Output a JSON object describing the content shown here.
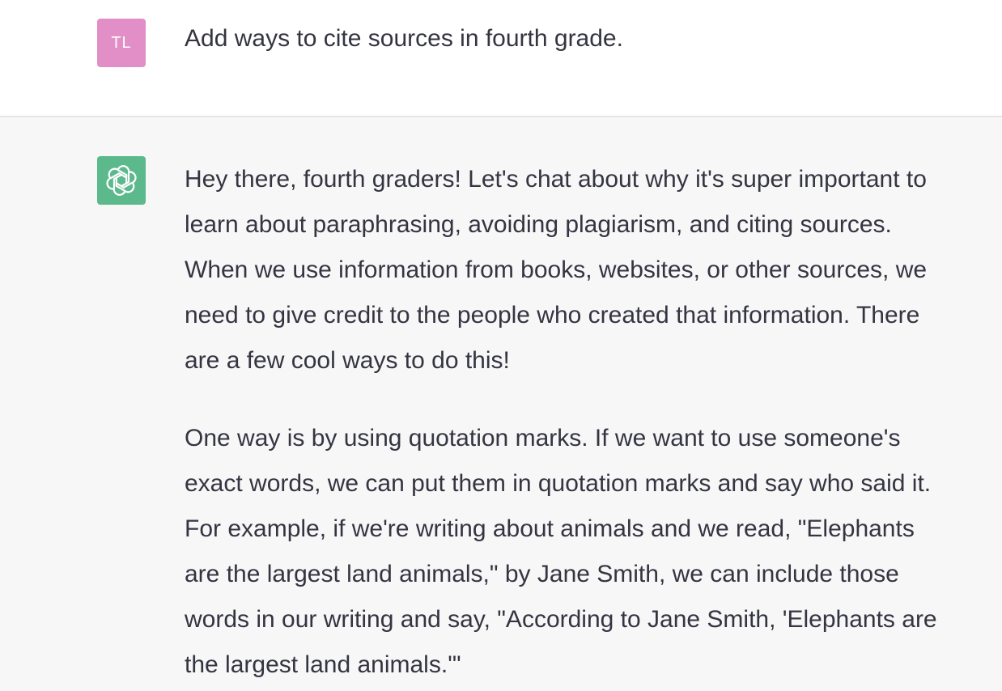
{
  "user_message": {
    "avatar_initials": "TL",
    "avatar_color": "#e18fc6",
    "text": "Add ways to cite sources in fourth grade."
  },
  "assistant_message": {
    "avatar_icon": "openai-logo-icon",
    "avatar_color": "#5bb98c",
    "paragraphs": [
      {
        "lines": [
          "Hey there, fourth graders! Let's chat about why it's super important to",
          "learn about paraphrasing, avoiding plagiarism, and citing sources.",
          "When we use information from books, websites, or other sources, we",
          "need to give credit to the people who created that information. There",
          "are a few cool ways to do this!"
        ]
      },
      {
        "lines": [
          "One way is by using quotation marks. If we want to use someone's",
          "exact words, we can put them in quotation marks and say who said it.",
          "For example, if we're writing about animals and we read, \"Elephants",
          "are the largest land animals,\" by Jane Smith, we can include those",
          "words in our writing and say, \"According to Jane Smith, 'Elephants are",
          "the largest land animals.'\""
        ]
      }
    ]
  }
}
